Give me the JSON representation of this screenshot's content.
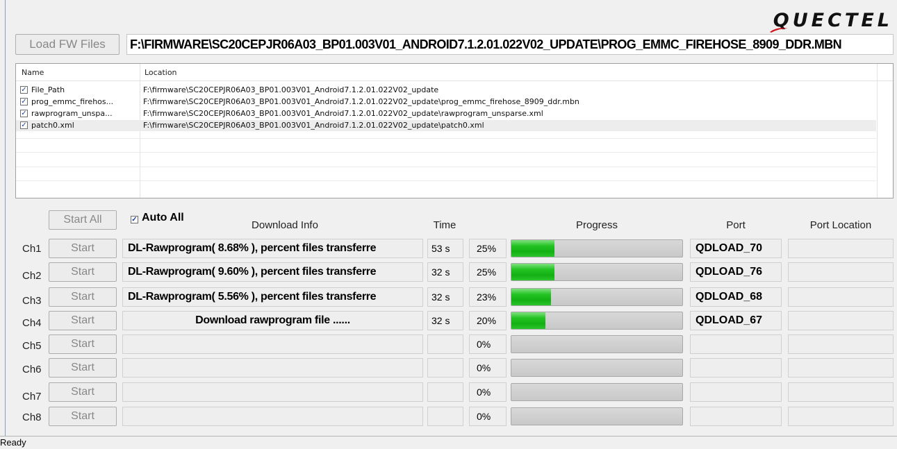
{
  "logo": {
    "text": "QUECTEL"
  },
  "toolbar": {
    "load_label": "Load FW Files",
    "path": "F:\\FIRMWARE\\SC20CEPJR06A03_BP01.003V01_ANDROID7.1.2.01.022V02_UPDATE\\PROG_EMMC_FIREHOSE_8909_DDR.MBN"
  },
  "files": {
    "col_name": "Name",
    "col_location": "Location",
    "rows": [
      {
        "name": "File_Path",
        "location": "F:\\firmware\\SC20CEPJR06A03_BP01.003V01_Android7.1.2.01.022V02_update",
        "checked": true
      },
      {
        "name": "prog_emmc_firehos...",
        "location": "F:\\firmware\\SC20CEPJR06A03_BP01.003V01_Android7.1.2.01.022V02_update\\prog_emmc_firehose_8909_ddr.mbn",
        "checked": true
      },
      {
        "name": "rawprogram_unspa...",
        "location": "F:\\firmware\\SC20CEPJR06A03_BP01.003V01_Android7.1.2.01.022V02_update\\rawprogram_unsparse.xml",
        "checked": true
      },
      {
        "name": "patch0.xml",
        "location": "F:\\firmware\\SC20CEPJR06A03_BP01.003V01_Android7.1.2.01.022V02_update\\patch0.xml",
        "checked": true
      }
    ]
  },
  "controls": {
    "start_all_label": "Start All",
    "auto_all_label": "Auto All",
    "auto_all_checked": true
  },
  "headers": {
    "download_info": "Download Info",
    "time": "Time",
    "progress": "Progress",
    "port": "Port",
    "port_location": "Port Location"
  },
  "channels": [
    {
      "label": "Ch1",
      "start": "Start",
      "info": "DL-Rawprogram( 8.68% ),  percent files transferre",
      "time": "53 s",
      "percent": "25%",
      "progress": 0.25,
      "port": "QDLOAD_70",
      "port_location": ""
    },
    {
      "label": "Ch2",
      "start": "Start",
      "info": "DL-Rawprogram( 9.60% ),  percent files transferre",
      "time": "32 s",
      "percent": "25%",
      "progress": 0.25,
      "port": "QDLOAD_76",
      "port_location": ""
    },
    {
      "label": "Ch3",
      "start": "Start",
      "info": "DL-Rawprogram( 5.56% ),  percent files transferre",
      "time": "32 s",
      "percent": "23%",
      "progress": 0.23,
      "port": "QDLOAD_68",
      "port_location": ""
    },
    {
      "label": "Ch4",
      "start": "Start",
      "info": "Download rawprogram file ......",
      "time": "32 s",
      "percent": "20%",
      "progress": 0.2,
      "port": "QDLOAD_67",
      "port_location": ""
    },
    {
      "label": "Ch5",
      "start": "Start",
      "info": "",
      "time": "",
      "percent": "0%",
      "progress": 0,
      "port": "",
      "port_location": ""
    },
    {
      "label": "Ch6",
      "start": "Start",
      "info": "",
      "time": "",
      "percent": "0%",
      "progress": 0,
      "port": "",
      "port_location": ""
    },
    {
      "label": "Ch7",
      "start": "Start",
      "info": "",
      "time": "",
      "percent": "0%",
      "progress": 0,
      "port": "",
      "port_location": ""
    },
    {
      "label": "Ch8",
      "start": "Start",
      "info": "",
      "time": "",
      "percent": "0%",
      "progress": 0,
      "port": "",
      "port_location": ""
    }
  ],
  "status": {
    "text": "Ready"
  },
  "colors": {
    "progress_fill": "#1cbf1c",
    "accent_red": "#d0141e"
  }
}
